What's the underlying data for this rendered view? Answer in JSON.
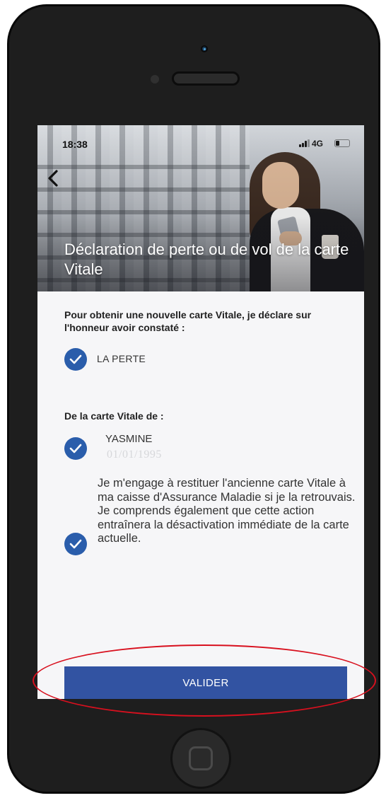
{
  "status_bar": {
    "time": "18:38",
    "network": "4G"
  },
  "header": {
    "back_icon": "chevron-left-icon",
    "title": "Déclaration de perte ou de vol de la carte Vitale"
  },
  "form": {
    "intro": "Pour obtenir une nouvelle carte Vitale, je déclare sur l'honneur avoir constaté :",
    "loss_option": {
      "label": "LA PERTE",
      "checked": true
    },
    "card_owner_heading": "De la carte Vitale de :",
    "card_owner": {
      "name": "YASMINE",
      "birth_date": "01/01/1995",
      "checked": true
    },
    "commitment": {
      "text": "Je m'engage à restituer l'ancienne carte Vitale à ma caisse d'Assurance Maladie si je la retrouvais. Je comprends également que cette action entraînera la désactivation immédiate de la carte actuelle.",
      "checked": true
    },
    "submit_label": "VALIDER"
  },
  "colors": {
    "accent": "#2a5dab",
    "button": "#3253a2",
    "annotation": "#d8101e",
    "device": "#1e1e1e"
  }
}
